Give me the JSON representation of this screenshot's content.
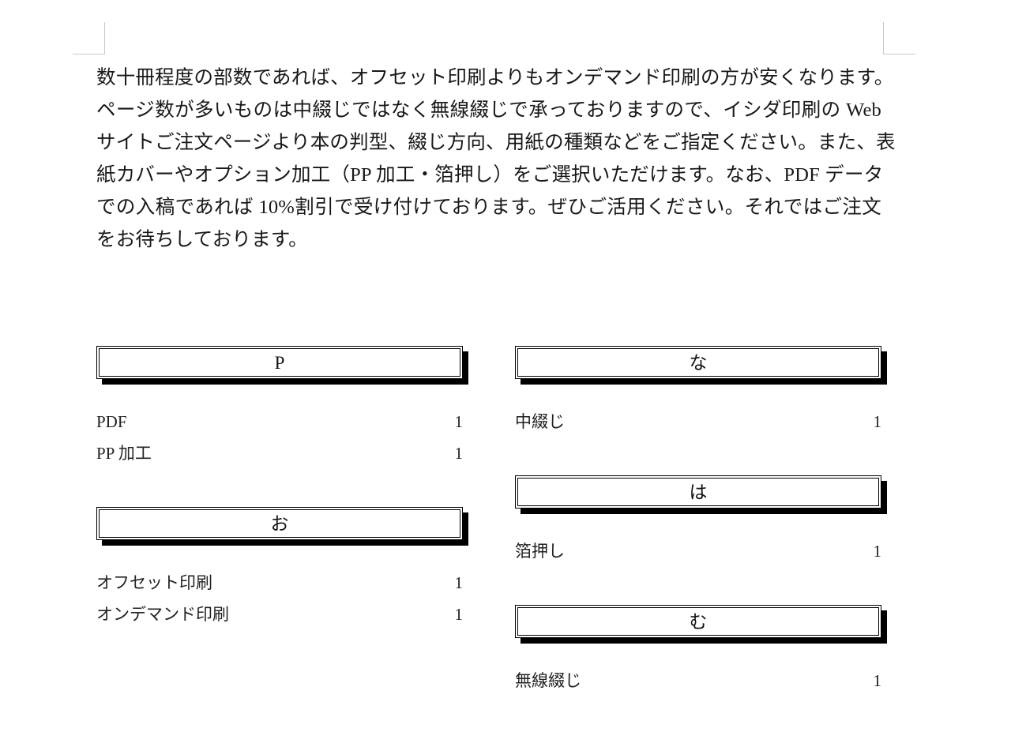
{
  "document": {
    "paragraph_lines": [
      "数十冊程度の部数であれば、オフセット印刷よりもオンデマンド印刷の方が安くなります。",
      "ページ数が多いものは中綴じではなく無線綴じで承っておりますので、イシダ印刷の Web",
      "サイトご注文ページより本の判型、綴じ方向、用紙の種類などをご指定ください。また、表",
      "紙カバーやオプション加工（PP 加工・箔押し）をご選択いただけます。なお、PDF データ",
      "での入稿であれば 10%割引で受け付けております。ぜひご活用ください。それではご注文",
      "をお待ちしております。"
    ]
  },
  "index": {
    "leader_dots": "..................................................................................................................",
    "columns": [
      {
        "sections": [
          {
            "letter": "P",
            "entries": [
              {
                "label": "PDF",
                "page": "1"
              },
              {
                "label": "PP 加工",
                "page": "1"
              }
            ]
          },
          {
            "letter": "お",
            "entries": [
              {
                "label": "オフセット印刷",
                "page": "1"
              },
              {
                "label": "オンデマンド印刷",
                "page": "1"
              }
            ]
          }
        ]
      },
      {
        "sections": [
          {
            "letter": "な",
            "entries": [
              {
                "label": "中綴じ",
                "page": "1"
              }
            ]
          },
          {
            "letter": "は",
            "entries": [
              {
                "label": "箔押し",
                "page": "1"
              }
            ]
          },
          {
            "letter": "む",
            "entries": [
              {
                "label": "無線綴じ",
                "page": "1"
              }
            ]
          }
        ]
      }
    ]
  },
  "page_marks": {
    "top_left": "margin-corner-mark",
    "top_right": "margin-corner-mark"
  }
}
